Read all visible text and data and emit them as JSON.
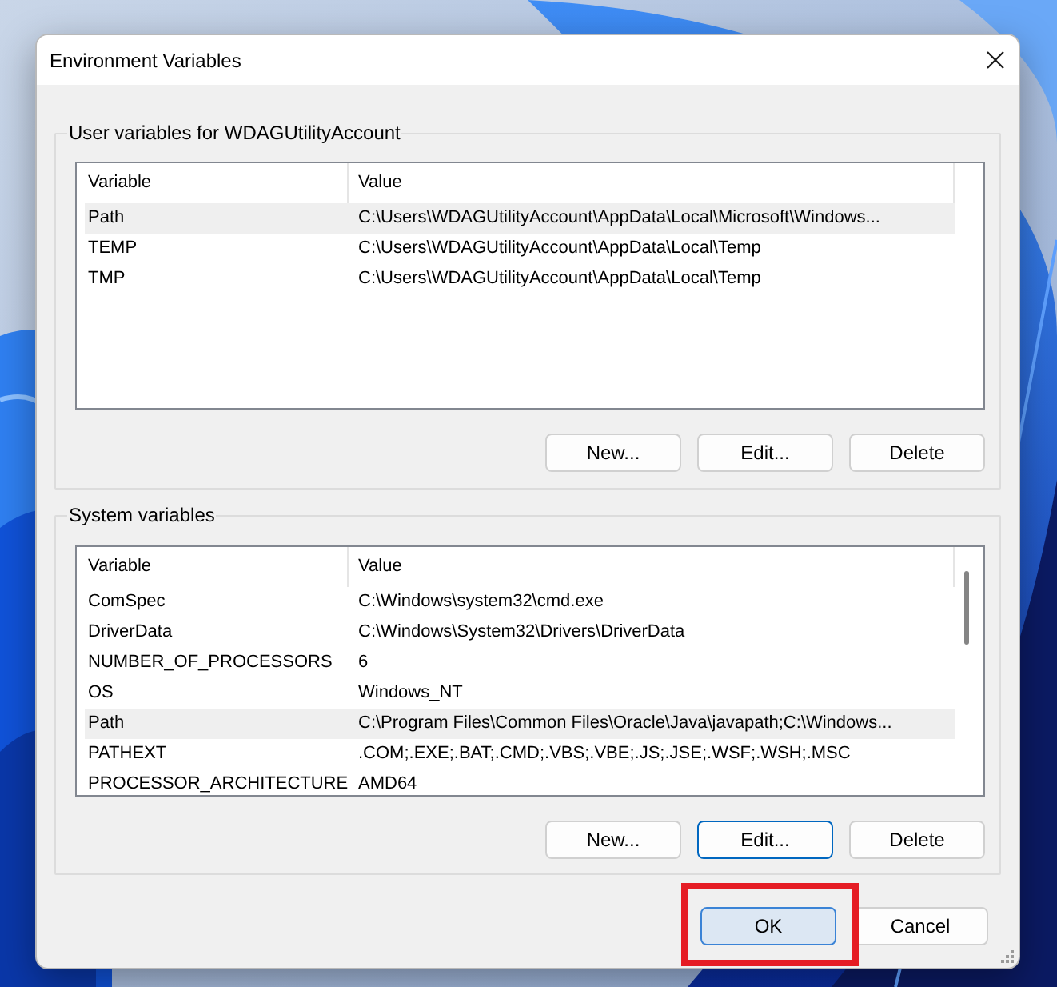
{
  "window": {
    "title": "Environment Variables"
  },
  "user_variables": {
    "legend": "User variables for WDAGUtilityAccount",
    "columns": [
      "Variable",
      "Value"
    ],
    "scrollbar": false,
    "rows": [
      {
        "variable": "Path",
        "value": "C:\\Users\\WDAGUtilityAccount\\AppData\\Local\\Microsoft\\Windows...",
        "selected": true
      },
      {
        "variable": "TEMP",
        "value": "C:\\Users\\WDAGUtilityAccount\\AppData\\Local\\Temp",
        "selected": false
      },
      {
        "variable": "TMP",
        "value": "C:\\Users\\WDAGUtilityAccount\\AppData\\Local\\Temp",
        "selected": false
      }
    ],
    "buttons": [
      {
        "label": "New...",
        "focused": false
      },
      {
        "label": "Edit...",
        "focused": false
      },
      {
        "label": "Delete",
        "focused": false
      }
    ]
  },
  "system_variables": {
    "legend": "System variables",
    "columns": [
      "Variable",
      "Value"
    ],
    "scrollbar": true,
    "rows": [
      {
        "variable": "ComSpec",
        "value": "C:\\Windows\\system32\\cmd.exe",
        "selected": false
      },
      {
        "variable": "DriverData",
        "value": "C:\\Windows\\System32\\Drivers\\DriverData",
        "selected": false
      },
      {
        "variable": "NUMBER_OF_PROCESSORS",
        "value": "6",
        "selected": false
      },
      {
        "variable": "OS",
        "value": "Windows_NT",
        "selected": false
      },
      {
        "variable": "Path",
        "value": "C:\\Program Files\\Common Files\\Oracle\\Java\\javapath;C:\\Windows...",
        "selected": true
      },
      {
        "variable": "PATHEXT",
        "value": ".COM;.EXE;.BAT;.CMD;.VBS;.VBE;.JS;.JSE;.WSF;.WSH;.MSC",
        "selected": false
      },
      {
        "variable": "PROCESSOR_ARCHITECTURE",
        "value": "AMD64",
        "selected": false
      }
    ],
    "buttons": [
      {
        "label": "New...",
        "focused": false
      },
      {
        "label": "Edit...",
        "focused": true
      },
      {
        "label": "Delete",
        "focused": false
      }
    ]
  },
  "dialog_buttons": [
    {
      "label": "OK",
      "default": true,
      "highlighted": true
    },
    {
      "label": "Cancel",
      "default": false,
      "highlighted": false
    }
  ]
}
